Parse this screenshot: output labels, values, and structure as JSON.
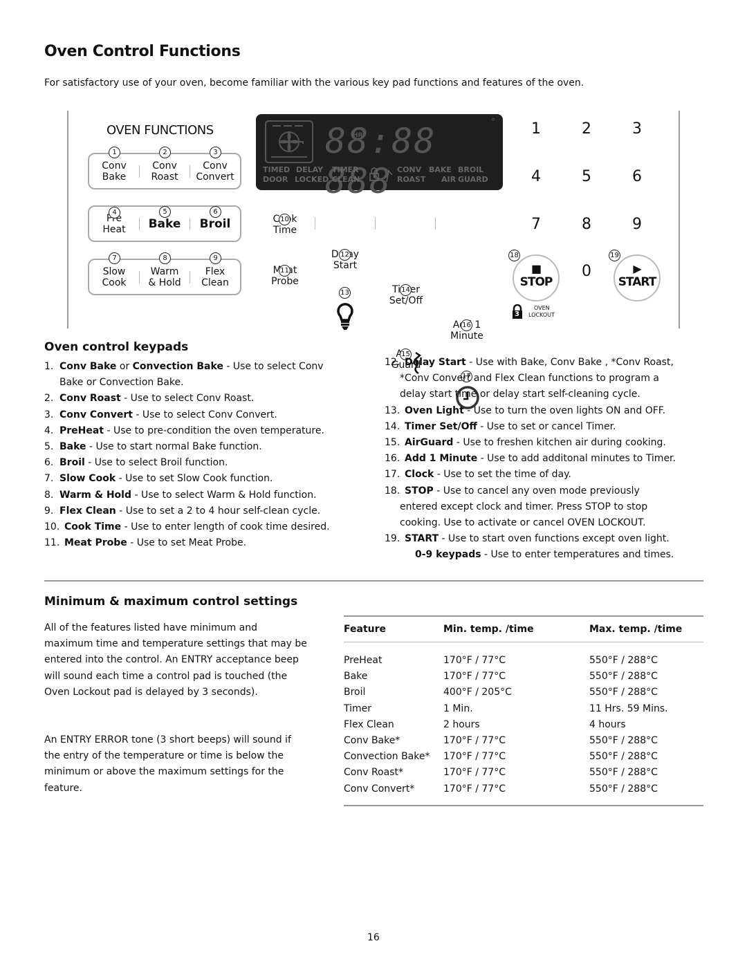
{
  "page": {
    "title": "Oven Control Functions",
    "intro": "For satisfactory use of your oven, become familiar with the various key pad functions and features of the oven.",
    "page_number": "16"
  },
  "panel": {
    "heading": "OVEN FUNCTIONS",
    "groups": [
      {
        "keys": [
          {
            "num": "1",
            "line1": "Conv",
            "line2": "Bake"
          },
          {
            "num": "2",
            "line1": "Conv",
            "line2": "Roast"
          },
          {
            "num": "3",
            "line1": "Conv",
            "line2": "Convert"
          }
        ]
      },
      {
        "keys": [
          {
            "num": "4",
            "line1": "Pre",
            "line2": "Heat"
          },
          {
            "num": "5",
            "line1": "Bake",
            "line2": ""
          },
          {
            "num": "6",
            "line1": "Broil",
            "line2": ""
          }
        ]
      },
      {
        "keys": [
          {
            "num": "7",
            "line1": "Slow",
            "line2": "Cook"
          },
          {
            "num": "8",
            "line1": "Warm",
            "line2": "& Hold"
          },
          {
            "num": "9",
            "line1": "Flex",
            "line2": "Clean"
          }
        ]
      }
    ],
    "lcd": {
      "digits": "88:88 888",
      "hr_label": "HR",
      "degree": "°",
      "labels_top": [
        "TIMED",
        "DELAY",
        "TIMER",
        "CONV",
        "BAKE",
        "BROIL"
      ],
      "labels_bottom": [
        "DOOR",
        "LOCKED",
        "CLEAN",
        "ROAST",
        "AIR",
        "GUARD"
      ]
    },
    "mid_keys_row1": [
      {
        "num": "10",
        "line1": "Cook",
        "line2": "Time"
      },
      {
        "num": "12",
        "line1": "Delay",
        "line2": "Start"
      },
      {
        "num": "14",
        "line1": "Timer",
        "line2": "Set/Off"
      },
      {
        "num": "16",
        "line1": "Add 1",
        "line2": "Minute"
      }
    ],
    "mid_keys_row2": [
      {
        "num": "11",
        "line1": "Meat",
        "line2": "Probe",
        "icon": ""
      },
      {
        "num": "13",
        "line1": "",
        "line2": "",
        "icon": "light-bulb-icon"
      },
      {
        "num": "15",
        "line1": "Air",
        "line2": "Guard",
        "icon": "air-wave-icon"
      },
      {
        "num": "17",
        "line1": "",
        "line2": "",
        "icon": "clock-icon"
      }
    ],
    "numpad": [
      "1",
      "2",
      "3",
      "4",
      "5",
      "6",
      "7",
      "8",
      "9",
      "0"
    ],
    "stop": {
      "num": "18",
      "label": "STOP",
      "glyph": "■"
    },
    "start": {
      "num": "19",
      "label": "START",
      "glyph": "▶"
    },
    "lockout": {
      "badge": "3",
      "line1": "OVEN",
      "line2": "LOCKOUT"
    }
  },
  "keypads": {
    "heading": "Oven control keypads",
    "left": [
      {
        "n": "1.",
        "bold": "Conv Bake",
        "mid": " or ",
        "bold2": "Convection Bake",
        "text": " - Use to select Conv",
        "cont": "Bake or Convection Bake."
      },
      {
        "n": "2.",
        "bold": "Conv Roast",
        "text": " - Use to select Conv Roast."
      },
      {
        "n": "3.",
        "bold": "Conv Convert",
        "text": " - Use to select Conv Convert."
      },
      {
        "n": "4.",
        "bold": "PreHeat",
        "text": " - Use to pre-condition the oven temperature."
      },
      {
        "n": "5.",
        "bold": "Bake",
        "text": " - Use to start normal Bake function."
      },
      {
        "n": "6.",
        "bold": "Broil",
        "text": " - Use to select Broil function."
      },
      {
        "n": "7.",
        "bold": "Slow Cook",
        "text": " - Use to set Slow Cook function."
      },
      {
        "n": "8.",
        "bold": "Warm & Hold",
        "text": " - Use to select Warm & Hold function."
      },
      {
        "n": "9.",
        "bold": "Flex Clean",
        "text": " - Use to set a 2 to 4 hour self-clean cycle."
      },
      {
        "n": "10.",
        "bold": "Cook Time",
        "text": " - Use to enter length of cook time desired."
      },
      {
        "n": "11.",
        "bold": "Meat Probe",
        "text": " - Use to set Meat Probe."
      }
    ],
    "right": [
      {
        "n": "12.",
        "bold": "Delay Start",
        "text": " - Use with Bake, Conv Bake , *Conv Roast,",
        "cont": "*Conv Convert and Flex Clean functions to program a",
        "cont2": "delay start time or delay start self-cleaning cycle."
      },
      {
        "n": "13.",
        "bold": "Oven Light",
        "text": " - Use to turn the oven lights ON and OFF."
      },
      {
        "n": "14.",
        "bold": "Timer Set/Off",
        "text": " - Use to set or cancel Timer."
      },
      {
        "n": "15.",
        "bold": "AirGuard",
        "text": " - Use to freshen kitchen air during cooking."
      },
      {
        "n": "16.",
        "bold": "Add 1 Minute",
        "text": " - Use to add additonal minutes to Timer."
      },
      {
        "n": "17.",
        "bold": "Clock",
        "text": " - Use to set the time of day."
      },
      {
        "n": "18.",
        "bold": "STOP",
        "text": " - Use to cancel any oven mode previously",
        "cont": "entered except clock and timer. Press STOP to stop",
        "cont2": "cooking. Use to activate or cancel OVEN LOCKOUT."
      },
      {
        "n": "19.",
        "bold": "START",
        "text": " - Use to start oven functions except oven light."
      },
      {
        "n": "",
        "bold": "0-9 keypads",
        "text": " - Use to enter temperatures and times."
      }
    ]
  },
  "settings": {
    "heading": "Minimum & maximum control settings",
    "para1": "All of the features listed have minimum and maximum time and temperature settings that may be entered into the control.  An ENTRY acceptance beep will sound each time a control pad is touched (the Oven Lockout pad is delayed by 3 seconds).",
    "para2": "An ENTRY ERROR tone (3 short beeps) will sound if the entry of the temperature or time is below the minimum or above the maximum settings for the feature.",
    "table": {
      "headers": [
        "Feature",
        "Min. temp. /time",
        "Max. temp. /time"
      ],
      "rows": [
        [
          "PreHeat",
          "170°F / 77°C",
          "550°F / 288°C"
        ],
        [
          "Bake",
          "170°F / 77°C",
          "550°F / 288°C"
        ],
        [
          "Broil",
          "400°F / 205°C",
          "550°F / 288°C"
        ],
        [
          "Timer",
          "1 Min.",
          "11 Hrs. 59 Mins."
        ],
        [
          "Flex Clean",
          "2 hours",
          "4 hours"
        ],
        [
          "Conv Bake*",
          "170°F / 77°C",
          "550°F / 288°C"
        ],
        [
          "Convection Bake*",
          "170°F / 77°C",
          "550°F / 288°C"
        ],
        [
          "Conv Roast*",
          "170°F / 77°C",
          "550°F / 288°C"
        ],
        [
          "Conv Convert*",
          "170°F / 77°C",
          "550°F / 288°C"
        ]
      ]
    }
  }
}
